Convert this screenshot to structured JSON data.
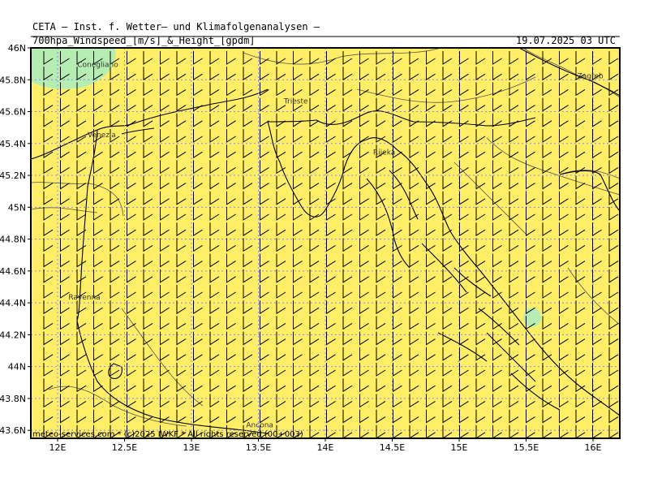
{
  "header": {
    "title": "CETA – Inst. f. Wetter– und Klimafolgenanalysen –",
    "subtitle": "700hpa_Windspeed_[m/s]_&_Height_[gpdm]",
    "valid_time": "19.07.2025 03 UTC"
  },
  "footer": {
    "copyright": "meteo-services.com * (c)2025 IWKF * All rights reserved (00+003)"
  },
  "axes": {
    "lat_labels": [
      "46N",
      "45.8N",
      "45.6N",
      "45.4N",
      "45.2N",
      "45N",
      "44.8N",
      "44.6N",
      "44.4N",
      "44.2N",
      "44N",
      "43.8N",
      "43.6N"
    ],
    "lat_values": [
      46,
      45.8,
      45.6,
      45.4,
      45.2,
      45,
      44.8,
      44.6,
      44.4,
      44.2,
      44,
      43.8,
      43.6
    ],
    "lon_labels": [
      "12E",
      "12.5E",
      "13E",
      "13.5E",
      "14E",
      "14.5E",
      "15E",
      "15.5E",
      "16E"
    ],
    "lon_values": [
      12,
      12.5,
      13,
      13.5,
      14,
      14.5,
      15,
      15.5,
      16
    ],
    "lon_range": [
      11.8,
      16.2
    ],
    "lat_range": [
      43.55,
      46
    ]
  },
  "cities": [
    {
      "name": "Conegliano",
      "lon": 12.3,
      "lat": 45.88
    },
    {
      "name": "Trieste",
      "lon": 13.78,
      "lat": 45.65
    },
    {
      "name": "Venezia",
      "lon": 12.33,
      "lat": 45.44
    },
    {
      "name": "Rijeka",
      "lon": 14.44,
      "lat": 45.33
    },
    {
      "name": "Zagreb",
      "lon": 15.98,
      "lat": 45.81
    },
    {
      "name": "Ravenna",
      "lon": 12.2,
      "lat": 44.42
    },
    {
      "name": "Ancona",
      "lon": 13.51,
      "lat": 43.62
    }
  ],
  "wind_field": {
    "direction": "northerly",
    "speed_range": "5–10 m/s",
    "barb": "single full barb"
  },
  "colors": {
    "field_main": "#ffee66",
    "field_low": "#b6edb2",
    "dotted_grid": "#8888ff",
    "coast": "#000000",
    "border": "#555555"
  }
}
